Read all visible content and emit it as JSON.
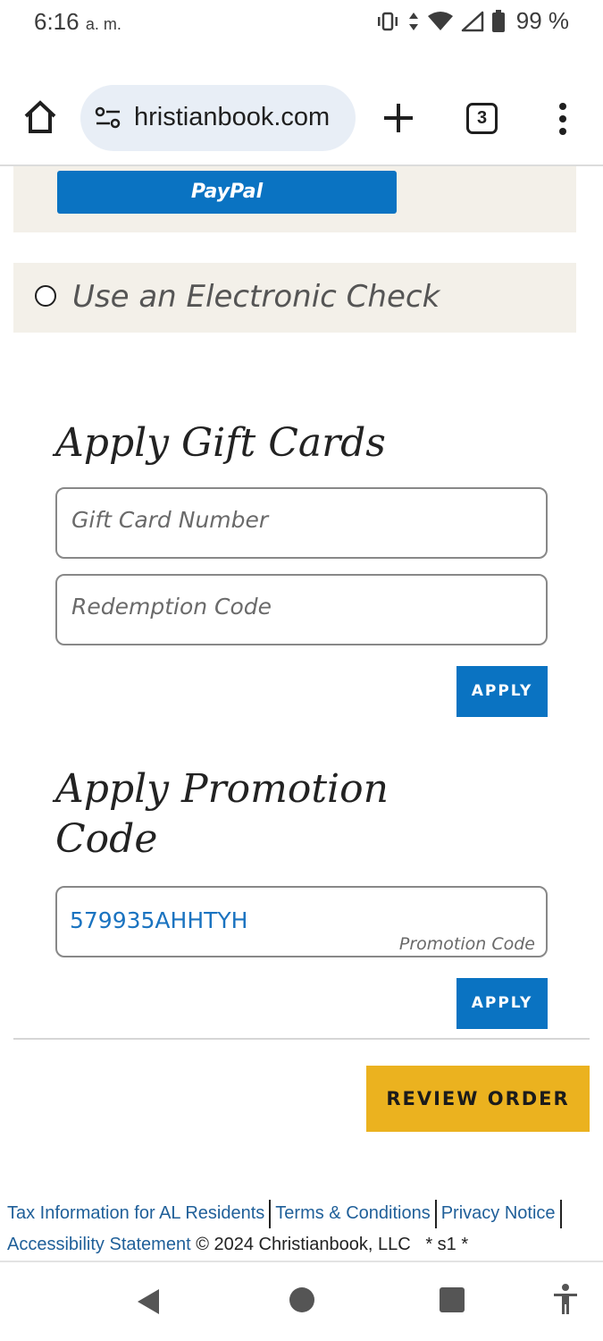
{
  "status_bar": {
    "time": "6:16",
    "ampm": "a. m.",
    "battery_pct": "99 %"
  },
  "browser": {
    "url": "hristianbook.com",
    "tab_count": "3"
  },
  "payment": {
    "paypal_label": "PayPal",
    "echeck_label": "Use an Electronic Check"
  },
  "gift_cards": {
    "title": "Apply Gift Cards",
    "card_number_placeholder": "Gift Card Number",
    "redemption_placeholder": "Redemption Code",
    "apply_label": "APPLY"
  },
  "promotion": {
    "title_line1": "Apply Promotion",
    "title_line2": "Code",
    "code_value": "579935AHHTYH",
    "code_label": "Promotion Code",
    "apply_label": "APPLY"
  },
  "review_order_label": "REVIEW ORDER",
  "footer": {
    "links": {
      "tax": "Tax Information for AL Residents",
      "terms": "Terms & Conditions",
      "privacy": "Privacy Notice",
      "accessibility": "Accessibility Statement"
    },
    "copyright": "© 2024 Christianbook, LLC",
    "server_tag": "* s1 *"
  },
  "colors": {
    "accent_blue": "#0a73c2",
    "review_yellow": "#ebb21f",
    "panel_beige": "#f3f0e9",
    "link_blue": "#1f5f99"
  },
  "icons": [
    "vibrate-icon",
    "data-arrows-icon",
    "wifi-icon",
    "signal-icon",
    "battery-icon",
    "home-icon",
    "site-settings-icon",
    "plus-icon",
    "tabs-icon",
    "more-vert-icon",
    "back-icon",
    "nav-home-icon",
    "recents-icon",
    "accessibility-icon"
  ]
}
